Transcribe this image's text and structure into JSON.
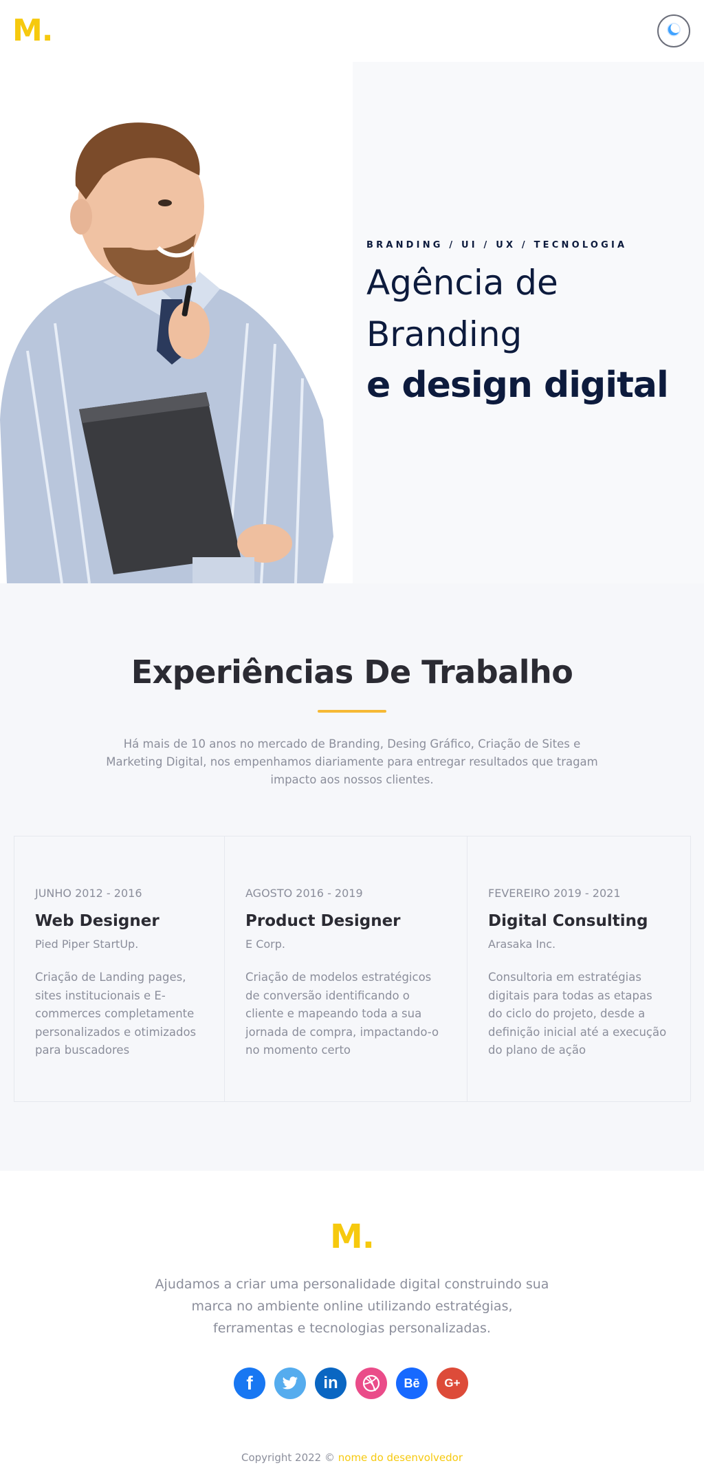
{
  "header": {
    "logo": "M.",
    "theme_toggle_icon": "moon-icon"
  },
  "hero": {
    "kicker": "BRANDING / UI / UX / TECNOLOGIA",
    "title_line1": "Agência de",
    "title_line2": "Branding",
    "title_bold": "e design digital",
    "image_alt": "man-holding-folder-photo"
  },
  "experiences": {
    "title": "Experiências De Trabalho",
    "intro": "Há mais de 10 anos no mercado de Branding, Desing Gráfico, Criação de Sites e Marketing Digital, nos empenhamos diariamente para entregar resultados que tragam impacto aos nossos clientes.",
    "cards": [
      {
        "date": "JUNHO 2012 - 2016",
        "role": "Web Designer",
        "company": "Pied Piper StartUp.",
        "description": "Criação de Landing pages, sites institucionais e E-commerces completamente personalizados e otimizados para buscadores"
      },
      {
        "date": "AGOSTO 2016 - 2019",
        "role": "Product Designer",
        "company": "E Corp.",
        "description": "Criação de modelos estratégicos de conversão identificando o cliente e mapeando toda a sua jornada de compra, impactando-o no momento certo"
      },
      {
        "date": "FEVEREIRO 2019 - 2021",
        "role": "Digital Consulting",
        "company": "Arasaka Inc.",
        "description": "Consultoria em estratégias digitais para todas as etapas do ciclo do projeto, desde a definição inicial até a execução do plano de ação"
      }
    ]
  },
  "footer": {
    "logo": "M.",
    "text": "Ajudamos a criar uma personalidade digital construindo sua marca no ambiente online utilizando estratégias, ferramentas e tecnologias personalizadas.",
    "socials": [
      {
        "icon": "facebook-icon",
        "color": "#1877f2",
        "glyph": "f"
      },
      {
        "icon": "twitter-icon",
        "color": "#55acee",
        "glyph": "t"
      },
      {
        "icon": "linkedin-icon",
        "color": "#0a66c2",
        "glyph": "in"
      },
      {
        "icon": "dribbble-icon",
        "color": "#ea4c89",
        "glyph": "◎"
      },
      {
        "icon": "behance-icon",
        "color": "#1769ff",
        "glyph": "Bē"
      },
      {
        "icon": "google-plus-icon",
        "color": "#dd4b39",
        "glyph": "G+"
      }
    ],
    "copyright_prefix": "Copyright 2022 ©",
    "copyright_link": "nome do desenvolvedor"
  },
  "colors": {
    "accent": "#f6c90e",
    "navy": "#0d1b3d",
    "divider": "#f6b935"
  }
}
